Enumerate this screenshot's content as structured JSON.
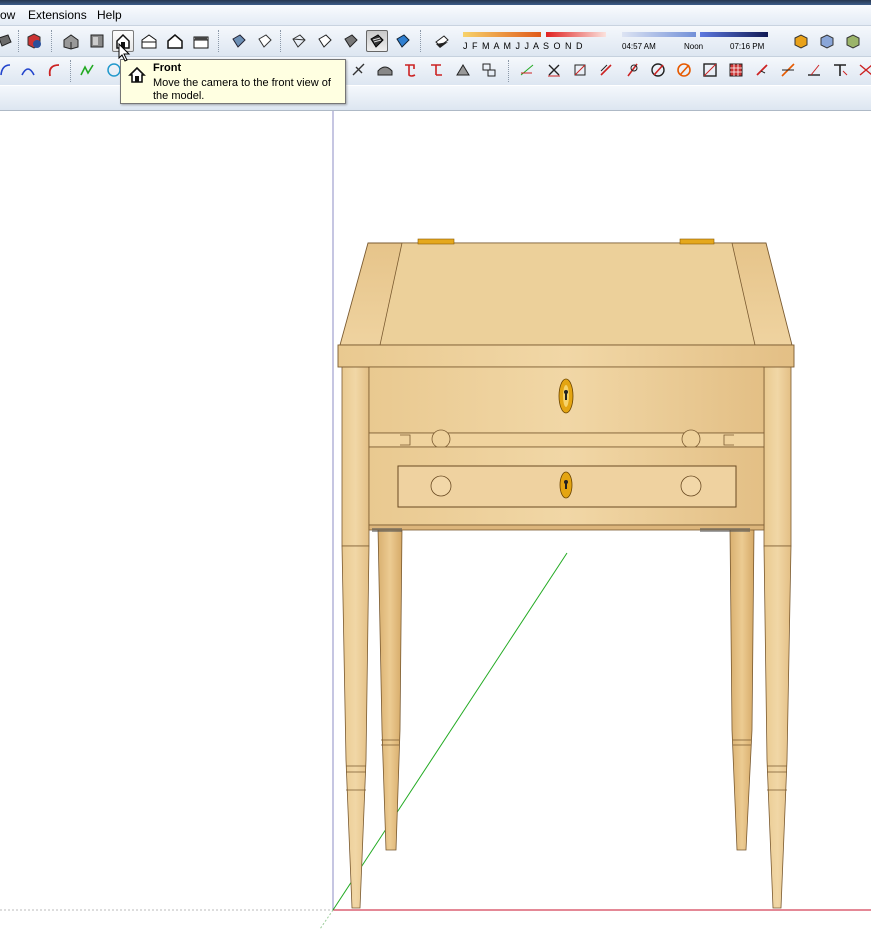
{
  "menu": {
    "items": [
      {
        "label": "ow"
      },
      {
        "label": "Extensions"
      },
      {
        "label": "Help"
      }
    ]
  },
  "shadows": {
    "months": "J F M A M J J A S O N D",
    "time_start": "04:57 AM",
    "time_noon": "Noon",
    "time_end": "07:16 PM"
  },
  "tooltip": {
    "title": "Front",
    "description": "Move the camera to the front view of the model.",
    "icon": "house-front-icon"
  },
  "toolbar": {
    "views": [
      "iso-view-icon",
      "top-view-icon",
      "front-view-icon",
      "right-view-icon",
      "back-view-icon",
      "left-view-icon"
    ],
    "styles": [
      "xray-icon",
      "wireframe-icon",
      "hidden-line-icon",
      "shaded-icon",
      "shaded-textures-icon",
      "monochrome-icon"
    ],
    "active_style": "shaded-textures-icon",
    "hovered_view": "front-view-icon"
  },
  "colors": {
    "axis_red": "#c8102e",
    "axis_green": "#22aa22",
    "axis_blue": "#6a6aaa",
    "wood": "#e4c088",
    "tooltip_bg": "#ffffe1"
  }
}
